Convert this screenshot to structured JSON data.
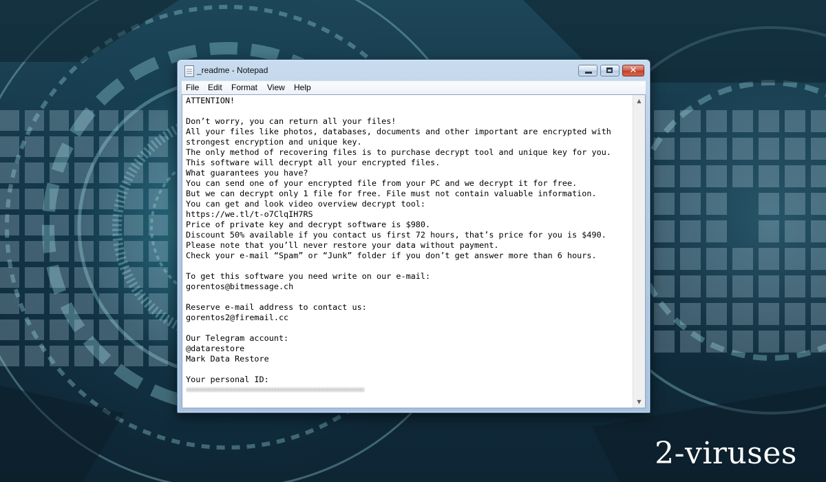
{
  "window": {
    "title": "_readme - Notepad",
    "close_glyph": "✕"
  },
  "menu": {
    "file": "File",
    "edit": "Edit",
    "format": "Format",
    "view": "View",
    "help": "Help"
  },
  "document": {
    "lines": [
      "ATTENTION!",
      "",
      "Don’t worry, you can return all your files!",
      "All your files like photos, databases, documents and other important are encrypted with",
      "strongest encryption and unique key.",
      "The only method of recovering files is to purchase decrypt tool and unique key for you.",
      "This software will decrypt all your encrypted files.",
      "What guarantees you have?",
      "You can send one of your encrypted file from your PC and we decrypt it for free.",
      "But we can decrypt only 1 file for free. File must not contain valuable information.",
      "You can get and look video overview decrypt tool:",
      "https://we.tl/t-o7ClqIH7RS",
      "Price of private key and decrypt software is $980.",
      "Discount 50% available if you contact us first 72 hours, that’s price for you is $490.",
      "Please note that you’ll never restore your data without payment.",
      "Check your e-mail “Spam” or “Junk” folder if you don’t get answer more than 6 hours.",
      "",
      "To get this software you need write on our e-mail:",
      "gorentos@bitmessage.ch",
      "",
      "Reserve e-mail address to contact us:",
      "gorentos2@firemail.cc",
      "",
      "Our Telegram account:",
      "@datarestore",
      "Mark Data Restore",
      "",
      "Your personal ID:"
    ]
  },
  "scrollbar": {
    "up_glyph": "▲",
    "down_glyph": "▼"
  },
  "watermark": {
    "text": "2-viruses"
  },
  "colors": {
    "close_button": "#c0402a",
    "titlebar": "#b3cbe4",
    "background": "#123244"
  }
}
